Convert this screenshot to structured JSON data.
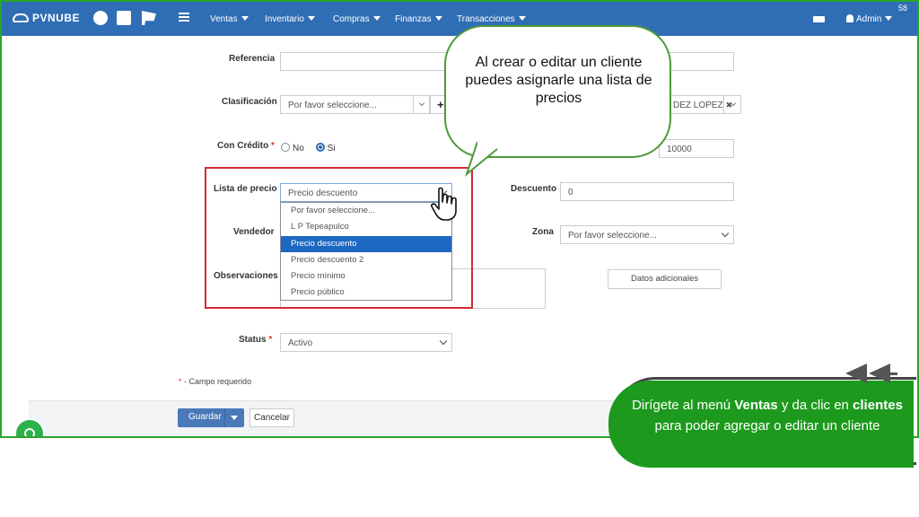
{
  "navbar": {
    "logo": "PVNUBE",
    "menus": [
      {
        "label": "Ventas"
      },
      {
        "label": "Inventario"
      },
      {
        "label": "Compras"
      },
      {
        "label": "Finanzas"
      },
      {
        "label": "Transacciones"
      }
    ],
    "user": "Admin",
    "page_number": "58"
  },
  "form": {
    "referencia_label": "Referencia",
    "clasificacion_label": "Clasificación",
    "clasificacion_placeholder": "Por favor seleccione...",
    "tag_value": "DEZ LOPEZ",
    "con_credito_label": "Con Crédito",
    "required_mark": "*",
    "radio_no": "No",
    "radio_si": "Si",
    "credit_limit": "10000",
    "lista_precio_label": "Lista de precio",
    "lista_precio_value": "Precio descuento",
    "descuento_label": "Descuento",
    "descuento_value": "0",
    "vendedor_label": "Vendedor",
    "zona_label": "Zona",
    "zona_value": "Por favor seleccione...",
    "observaciones_label": "Observaciones",
    "datos_adicionales": "Datos adicionales",
    "status_label": "Status",
    "status_value": "Activo",
    "campo_requerido": "- Campo requerido",
    "save_label": "Guardar",
    "cancel_label": "Cancelar"
  },
  "dropdown_options": [
    "Por favor seleccione...",
    "L P Tepeapulco",
    "Precio descuento",
    "Precio descuento 2",
    "Precio mínimo",
    "Precio público"
  ],
  "dropdown_selected_index": 2,
  "callouts": {
    "top": "Al crear o editar un cliente puedes asignarle una lista de precios",
    "bottom_pre": "Dirígete al menú ",
    "bottom_bold1": "Ventas",
    "bottom_mid": " y da clic en ",
    "bottom_bold2": "clientes",
    "bottom_post": " para poder agregar o editar un cliente"
  },
  "colors": {
    "navbar": "#2f6db5",
    "highlight_box": "#d42a36",
    "selected_option": "#1e67c2",
    "callout_green": "#1d9a1d",
    "frame_green": "#2aa52a"
  }
}
